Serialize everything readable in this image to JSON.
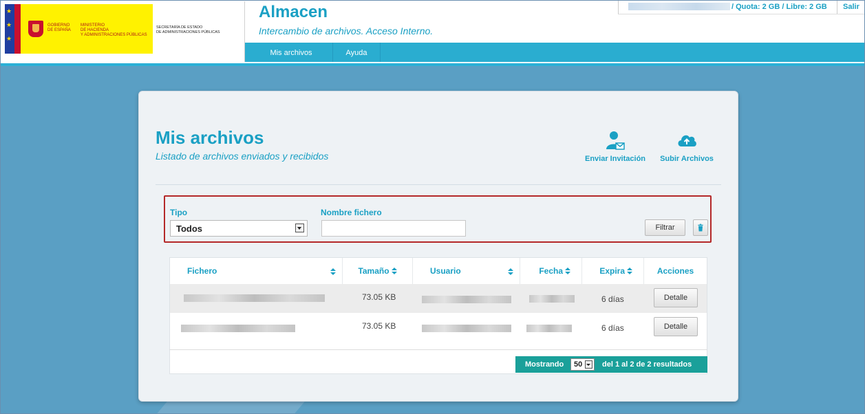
{
  "header": {
    "logo": {
      "gobierno": [
        "GOBIERNO",
        "DE ESPAÑA"
      ],
      "ministerio": [
        "MINISTERIO",
        "DE HACIENDA",
        "Y ADMINISTRACIONES PÚBLICAS"
      ],
      "secretaria": [
        "SECRETARÍA DE ESTADO",
        "DE ADMINISTRACIONES PÚBLICAS"
      ]
    },
    "app_title": "Almacen",
    "app_subtitle": "Intercambio de archivos. Acceso Interno.",
    "quota": "/ Quota: 2 GB / Libre: 2 GB",
    "logout": "Salir",
    "nav": [
      "Mis archivos",
      "Ayuda"
    ]
  },
  "page": {
    "title": "Mis archivos",
    "subtitle": "Listado de archivos enviados y recibidos",
    "actions": [
      {
        "label": "Enviar Invitación",
        "icon": "user-invite-icon"
      },
      {
        "label": "Subir Archivos",
        "icon": "cloud-upload-icon"
      }
    ]
  },
  "filter": {
    "type_label": "Tipo",
    "type_value": "Todos",
    "name_label": "Nombre fichero",
    "name_value": "",
    "filter_button": "Filtrar"
  },
  "table": {
    "columns": [
      "Fichero",
      "Tamaño",
      "Usuario",
      "Fecha",
      "Expira",
      "Acciones"
    ],
    "rows": [
      {
        "size": "73.05 KB",
        "expira": "6 días",
        "action": "Detalle"
      },
      {
        "size": "73.05 KB",
        "expira": "6 días",
        "action": "Detalle"
      }
    ]
  },
  "pagination": {
    "showing": "Mostrando",
    "page_size": "50",
    "summary": "del 1 al 2 de 2 resultados"
  },
  "colors": {
    "accent": "#1aa0c4",
    "nav": "#2aadd0",
    "pager": "#1aa09a",
    "highlight_border": "#b42828"
  }
}
